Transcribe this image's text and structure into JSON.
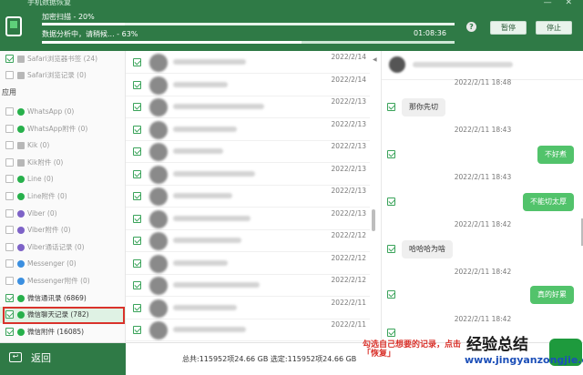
{
  "window": {
    "title": "手机数据恢复",
    "controls": "— ✕"
  },
  "scan": {
    "label": "加密扫描 - 20%",
    "progress": 0.2
  },
  "analysis": {
    "label": "数据分析中，请稍候... - 63%",
    "progress": 0.63,
    "timer": "01:08:36"
  },
  "buttons": {
    "help": "?",
    "pause": "暂停",
    "stop": "停止"
  },
  "sidebar": {
    "top_items": [
      {
        "label": "Safari浏览器书签 (24)",
        "checked": true
      },
      {
        "label": "Safari浏览记录 (0)",
        "checked": false
      }
    ],
    "section": "应用",
    "app_items": [
      {
        "label": "WhatsApp (0)",
        "checked": false,
        "icon": "whatsapp-icon"
      },
      {
        "label": "WhatsApp附件 (0)",
        "checked": false,
        "icon": "whatsapp-icon"
      },
      {
        "label": "Kik (0)",
        "checked": false,
        "icon": "kik-icon"
      },
      {
        "label": "Kik附件 (0)",
        "checked": false,
        "icon": "kik-icon"
      },
      {
        "label": "Line (0)",
        "checked": false,
        "icon": "line-icon"
      },
      {
        "label": "Line附件 (0)",
        "checked": false,
        "icon": "line-icon"
      },
      {
        "label": "Viber (0)",
        "checked": false,
        "icon": "viber-icon"
      },
      {
        "label": "Viber附件 (0)",
        "checked": false,
        "icon": "viber-icon"
      },
      {
        "label": "Viber通话记录 (0)",
        "checked": false,
        "icon": "viber-icon"
      },
      {
        "label": "Messenger (0)",
        "checked": false,
        "icon": "messenger-icon"
      },
      {
        "label": "Messenger附件 (0)",
        "checked": false,
        "icon": "messenger-icon"
      },
      {
        "label": "微信通讯录 (6869)",
        "checked": true,
        "icon": "wechat-icon"
      },
      {
        "label": "微信聊天记录 (782)",
        "checked": true,
        "icon": "wechat-icon",
        "selected": true
      },
      {
        "label": "微信附件 (16085)",
        "checked": true,
        "icon": "wechat-icon"
      }
    ]
  },
  "list": {
    "dates": [
      "2022/2/14",
      "2022/2/14",
      "2022/2/13",
      "2022/2/13",
      "2022/2/13",
      "2022/2/13",
      "2022/2/13",
      "2022/2/13",
      "2022/2/12",
      "2022/2/12",
      "2022/2/12",
      "2022/2/11",
      "2022/2/11"
    ]
  },
  "chat": {
    "messages": [
      {
        "time": "2022/2/11 18:48",
        "text": "那你先切",
        "dir": "in"
      },
      {
        "time": "2022/2/11 18:43",
        "text": "不好煮",
        "dir": "out"
      },
      {
        "time": "2022/2/11 18:43",
        "text": "不能切太厚",
        "dir": "out"
      },
      {
        "time": "2022/2/11 18:42",
        "text": "哈哈哈为啥",
        "dir": "in"
      },
      {
        "time": "2022/2/11 18:42",
        "text": "真的好累",
        "dir": "out"
      },
      {
        "time": "2022/2/11 18:42",
        "text": "",
        "dir": "out"
      }
    ]
  },
  "footer": {
    "back": "返回",
    "status": "总共:115952项24.66 GB 选定:115952项24.66 GB",
    "note": "勾选自己想要的记录，点击「恢复」",
    "watermark": "经验总结",
    "watermark_url": "www.jingyanzongjie.com"
  }
}
